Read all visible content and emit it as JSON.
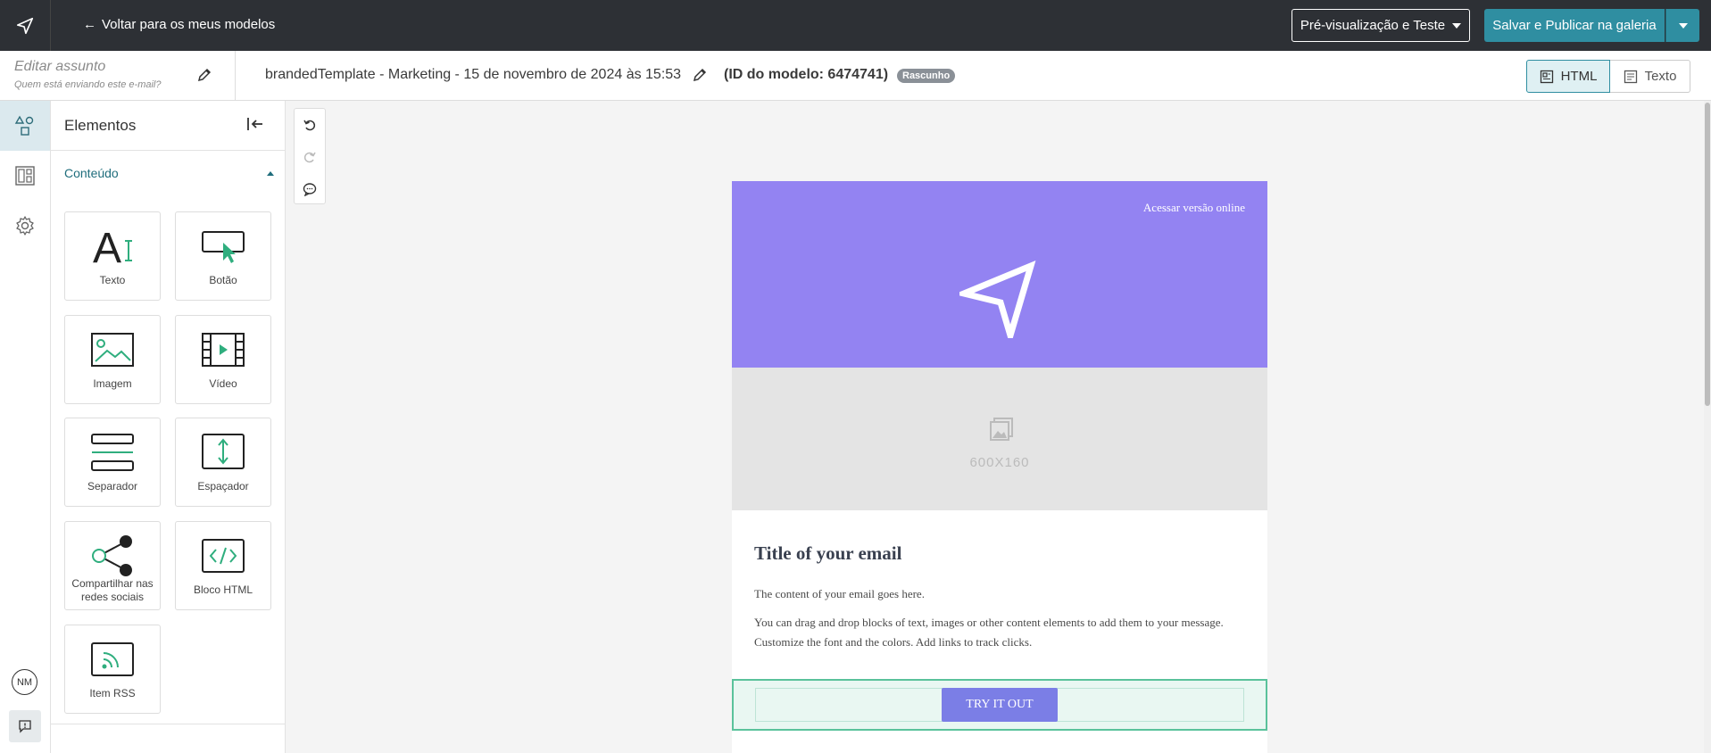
{
  "topbar": {
    "back_label": "Voltar para os meus modelos",
    "preview_label": "Pré-visualização e Teste",
    "publish_label": "Salvar e Publicar na galeria"
  },
  "subbar": {
    "subject_placeholder": "Editar assunto",
    "sender_placeholder": "Quem está enviando este e-mail?",
    "template_name": "brandedTemplate - Marketing - 15 de novembro de 2024 às 15:53",
    "template_id": "(ID do modelo: 6474741)",
    "status_badge": "Rascunho",
    "view_html": "HTML",
    "view_text": "Texto"
  },
  "rail": {
    "avatar_initials": "NM"
  },
  "panel": {
    "title": "Elementos",
    "section": "Conteúdo",
    "tiles": [
      {
        "label": "Texto",
        "icon": "text-icon"
      },
      {
        "label": "Botão",
        "icon": "button-icon"
      },
      {
        "label": "Imagem",
        "icon": "image-icon"
      },
      {
        "label": "Vídeo",
        "icon": "video-icon"
      },
      {
        "label": "Separador",
        "icon": "divider-icon"
      },
      {
        "label": "Espaçador",
        "icon": "spacer-icon"
      },
      {
        "label": "Compartilhar nas redes sociais",
        "icon": "share-icon"
      },
      {
        "label": "Bloco HTML",
        "icon": "code-icon"
      },
      {
        "label": "Item RSS",
        "icon": "rss-icon"
      }
    ]
  },
  "email": {
    "online_link": "Acessar versão online",
    "image_placeholder": "600X160",
    "title": "Title of your email",
    "paragraph1": "The content of your email goes here.",
    "paragraph2": "You can drag and drop blocks of text, images or other content elements to add them to your message. Customize the font and the colors. Add links to track clicks.",
    "cta_label": "TRY IT OUT"
  },
  "colors": {
    "topbar": "#2d3035",
    "accent": "#2f8ea1",
    "hero": "#9383f2",
    "cta": "#7b7ee6",
    "selection": "#5ac29b"
  }
}
